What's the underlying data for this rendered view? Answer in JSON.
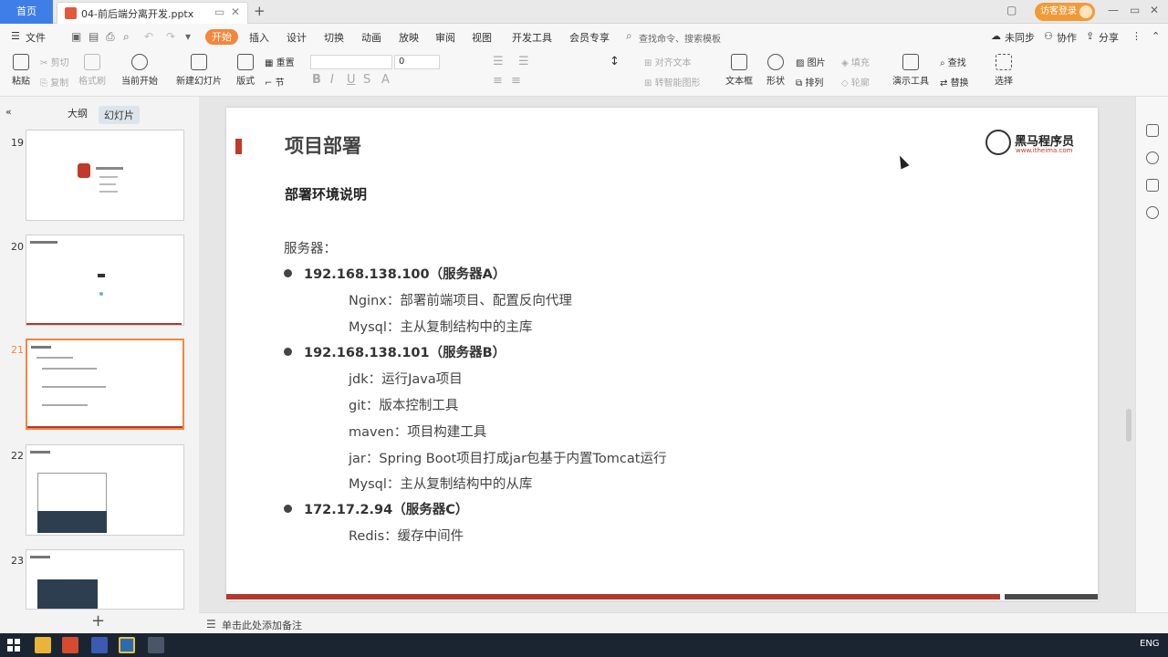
{
  "titlebar": {
    "home_tab": "首页",
    "doc_tab": "04-前后端分离开发.pptx",
    "new_tab": "+",
    "login_label": "访客登录",
    "win_ctl": [
      "▢",
      "—",
      "▭",
      "✕"
    ]
  },
  "menubar": {
    "file_label": "文件",
    "active_tab": "开始",
    "tabs": [
      "插入",
      "设计",
      "切换",
      "动画",
      "放映",
      "审阅",
      "视图",
      "开发工具",
      "会员专享"
    ],
    "search_placeholder": "查找命令、搜索模板",
    "right_items": [
      "未同步",
      "协作",
      "分享"
    ]
  },
  "ribbon": {
    "paste": "粘贴",
    "cut": "剪切",
    "copy": "复制",
    "format_painter": "格式刷",
    "from_current": "当前开始",
    "new_slide": "新建幻灯片",
    "layout": "版式",
    "section": "节",
    "reset": "重置",
    "font_size": "0",
    "align_text": "对齐文本",
    "convert_smartart": "转智能图形",
    "textbox": "文本框",
    "shape": "形状",
    "picture": "图片",
    "fill": "填充",
    "arrange": "排列",
    "outline": "轮廓",
    "present_tools": "演示工具",
    "find": "查找",
    "replace": "替换",
    "select": "选择"
  },
  "leftpane": {
    "tab_outline": "大纲",
    "tab_slides": "幻灯片",
    "slide_numbers": [
      "19",
      "20",
      "21",
      "22",
      "23"
    ],
    "add_slide": "+"
  },
  "slide": {
    "title": "项目部署",
    "subtitle": "部署环境说明",
    "logo_name": "黑马程序员",
    "logo_url": "www.itheima.com",
    "server_label": "服务器：",
    "server_a": "192.168.138.100（服务器A）",
    "a_line1": "Nginx：部署前端项目、配置反向代理",
    "a_line2": "Mysql：主从复制结构中的主库",
    "server_b": "192.168.138.101（服务器B）",
    "b_line1": "jdk：运行Java项目",
    "b_line2": "git：版本控制工具",
    "b_line3": "maven：项目构建工具",
    "b_line4": "jar：Spring Boot项目打成jar包基于内置Tomcat运行",
    "b_line5": "Mysql：主从复制结构中的从库",
    "server_c": "172.17.2.94（服务器C）",
    "c_line1": "Redis：缓存中间件"
  },
  "notes": {
    "placeholder": "单击此处添加备注"
  },
  "taskbar": {
    "lang": "ENG"
  }
}
